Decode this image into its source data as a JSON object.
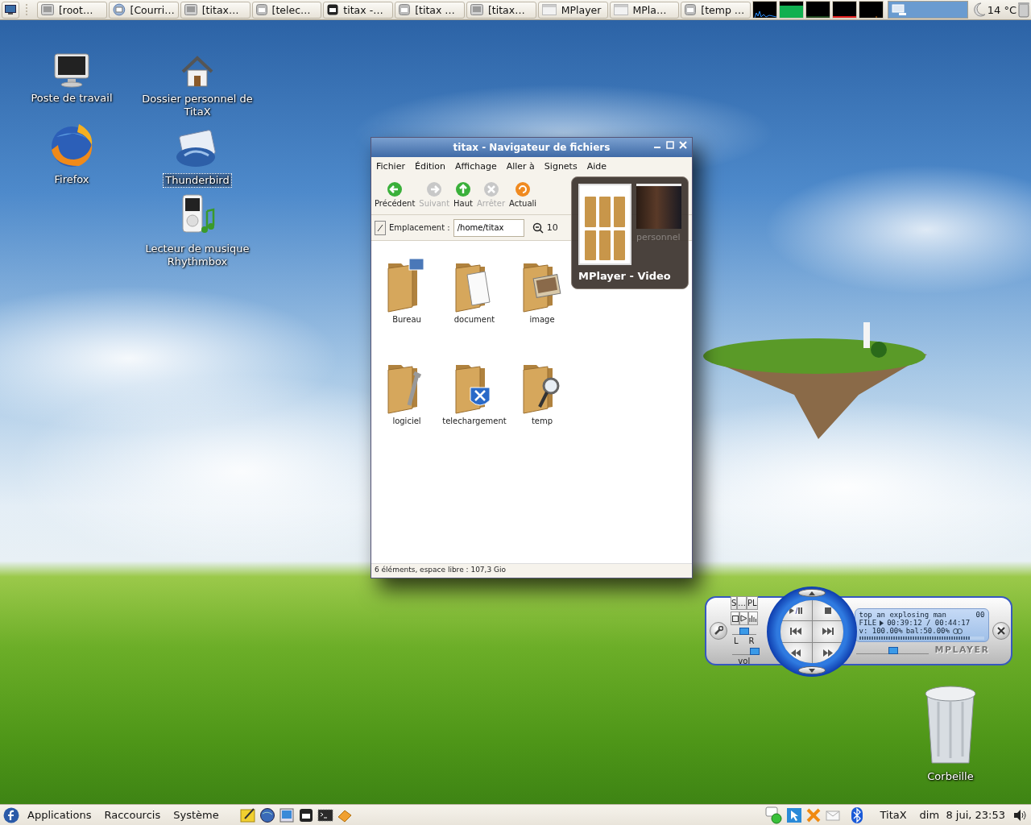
{
  "top_panel": {
    "tasks": [
      {
        "label": "[root…",
        "kind": "screen"
      },
      {
        "label": "[Courri…",
        "kind": "mail"
      },
      {
        "label": "[titax…",
        "kind": "screen"
      },
      {
        "label": "[telec…",
        "kind": "app"
      },
      {
        "label": "titax -…",
        "kind": "console"
      },
      {
        "label": "[titax …",
        "kind": "app"
      },
      {
        "label": "[titax…",
        "kind": "screen"
      },
      {
        "label": "MPlayer",
        "kind": "media"
      },
      {
        "label": "MPla…",
        "kind": "media"
      },
      {
        "label": "[temp …",
        "kind": "app"
      }
    ],
    "weather": "14 °C"
  },
  "desktop_icons": [
    {
      "label": "Poste de travail",
      "kind": "computer",
      "selected": false
    },
    {
      "label": "Dossier personnel de TitaX",
      "kind": "home",
      "selected": false
    },
    {
      "label": "Firefox",
      "kind": "browser",
      "selected": false
    },
    {
      "label": "Thunderbird",
      "kind": "mail",
      "selected": true
    },
    {
      "label": "Lecteur de musique Rhythmbox",
      "kind": "music",
      "selected": false
    }
  ],
  "file_manager": {
    "title": "titax - Navigateur de fichiers",
    "menu": [
      "Fichier",
      "Édition",
      "Affichage",
      "Aller à",
      "Signets",
      "Aide"
    ],
    "toolbar": [
      {
        "label": "Précédent",
        "kind": "back",
        "disabled": false
      },
      {
        "label": "Suivant",
        "kind": "forward",
        "disabled": true
      },
      {
        "label": "Haut",
        "kind": "up",
        "disabled": false
      },
      {
        "label": "Arrêter",
        "kind": "stop",
        "disabled": true
      },
      {
        "label": "Actuali",
        "kind": "reload",
        "disabled": false
      }
    ],
    "location_label": "Emplacement :",
    "location": "/home/titax",
    "zoom": "10",
    "folders": [
      {
        "label": "Bureau",
        "kind": "desktop"
      },
      {
        "label": "document",
        "kind": "document"
      },
      {
        "label": "image",
        "kind": "image"
      },
      {
        "label": "logiciel",
        "kind": "tools"
      },
      {
        "label": "telechargement",
        "kind": "download"
      },
      {
        "label": "temp",
        "kind": "search"
      }
    ],
    "status": "6 éléments, espace libre : 107,3 Gio"
  },
  "window_switcher": {
    "caption": "MPlayer - Video",
    "behind_text": "personnel"
  },
  "mplayer": {
    "buttons": [
      "S",
      "...",
      "PL"
    ],
    "balance_slider": {
      "level": 0.5
    },
    "left": "L",
    "right": "R",
    "volume_slider": {
      "level": 0.95
    },
    "volume_label": "vol",
    "title": "top an explosing man",
    "track": "00",
    "file_label": "FILE",
    "time": "00:39:12 / 00:44:17",
    "volume_readout": "v: 100.00%",
    "balance_readout": "bal:50.00%",
    "progress": {
      "level": 0.89
    },
    "seek_slider": {
      "level": 0.52
    },
    "brand": "MPLAYER"
  },
  "trash": "Corbeille",
  "bottom_panel": {
    "menus": [
      "Applications",
      "Raccourcis",
      "Système"
    ],
    "user": "TitaX",
    "clock": "dim  8 jui, 23:53"
  }
}
